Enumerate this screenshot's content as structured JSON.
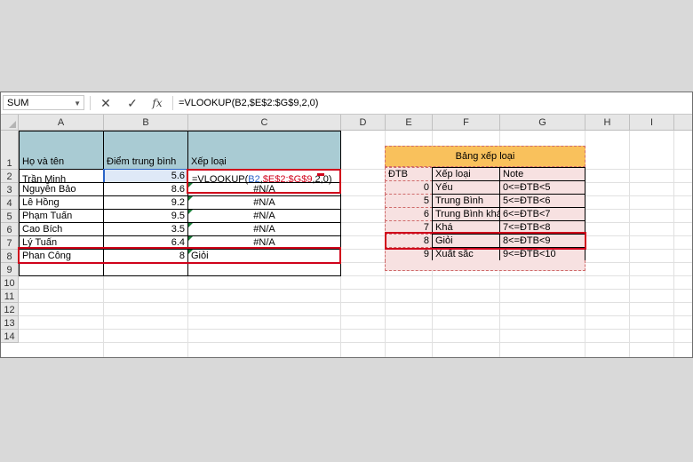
{
  "formula_bar": {
    "name_box": "SUM",
    "cancel_icon": "cancel-icon",
    "enter_icon": "check-icon",
    "function_icon": "fx-icon",
    "fx_label": "fx",
    "formula": "=VLOOKUP(B2,$E$2:$G$9,2,0)"
  },
  "columns": [
    "A",
    "B",
    "C",
    "D",
    "E",
    "F",
    "G",
    "H",
    "I"
  ],
  "rows": [
    "1",
    "2",
    "3",
    "4",
    "5",
    "6",
    "7",
    "8",
    "9",
    "10",
    "11",
    "12",
    "13",
    "14"
  ],
  "main_table": {
    "headers": [
      "Họ và tên",
      "Điểm trung bình",
      "Xếp loại"
    ],
    "rows": [
      {
        "name": "Trần Minh",
        "score": "5.6",
        "rank": ""
      },
      {
        "name": "Nguyễn Bảo",
        "score": "8.6",
        "rank": "#N/A"
      },
      {
        "name": "Lê Hồng",
        "score": "9.2",
        "rank": "#N/A"
      },
      {
        "name": "Phạm Tuấn",
        "score": "9.5",
        "rank": "#N/A"
      },
      {
        "name": "Cao Bích",
        "score": "3.5",
        "rank": "#N/A"
      },
      {
        "name": "Lý Tuấn",
        "score": "6.4",
        "rank": "#N/A"
      },
      {
        "name": "Phan Công",
        "score": "8",
        "rank": "Giỏi"
      }
    ],
    "edit_formula": {
      "prefix": "=VLOOKUP(",
      "ref1": "B2",
      "sep1": ",",
      "ref2": "$E$2:$G$9",
      "suffix": ",2,0)"
    }
  },
  "rank_table": {
    "title": "Bảng xếp loại",
    "headers": [
      "ĐTB",
      "Xếp loại",
      "Note"
    ],
    "rows": [
      {
        "dtb": "0",
        "rank": "Yếu",
        "note": "0<=ĐTB<5"
      },
      {
        "dtb": "5",
        "rank": "Trung Bình",
        "note": "5<=ĐTB<6"
      },
      {
        "dtb": "6",
        "rank": "Trung Bình khá",
        "note": "6<=ĐTB<7"
      },
      {
        "dtb": "7",
        "rank": "Khá",
        "note": "7<=ĐTB<8"
      },
      {
        "dtb": "8",
        "rank": "Giỏi",
        "note": "8<=ĐTB<9"
      },
      {
        "dtb": "9",
        "rank": "Xuất sắc",
        "note": "9<=ĐTB<10"
      }
    ]
  },
  "colors": {
    "header_fill": "#a9cbd3",
    "rank_title_fill": "#f9c15c",
    "rank_fill": "#f7e1e1",
    "highlight": "#d0021b",
    "ref_blue": "#2a64c8"
  }
}
